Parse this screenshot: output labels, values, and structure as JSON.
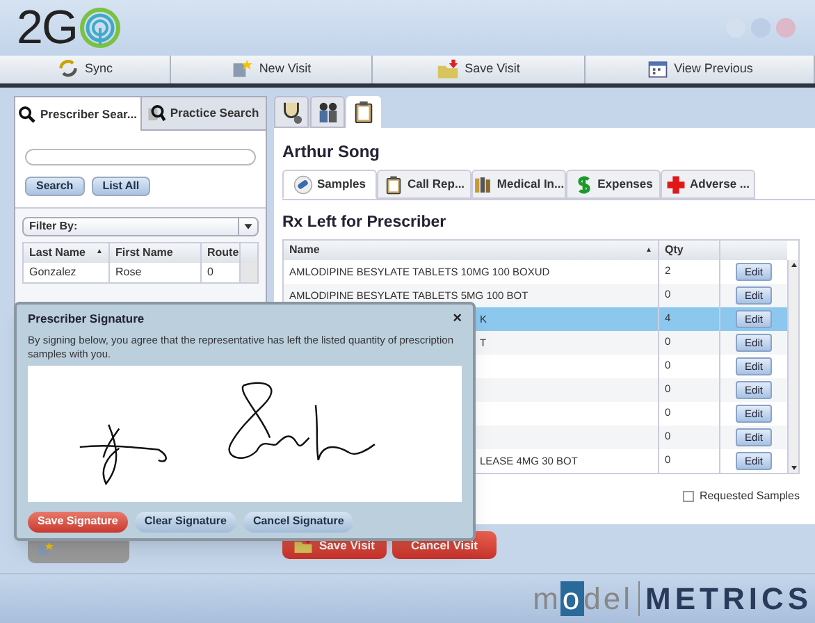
{
  "app": {
    "logo": "2G"
  },
  "toolbar": [
    {
      "kind": "sync",
      "label": "Sync"
    },
    {
      "kind": "new",
      "label": "New Visit"
    },
    {
      "kind": "save",
      "label": "Save Visit"
    },
    {
      "kind": "calendar",
      "label": "View Previous"
    }
  ],
  "search_panel": {
    "tabs": [
      {
        "kind": "person",
        "label": "Prescriber Sear...",
        "selected": true
      },
      {
        "kind": "building",
        "label": "Practice Search",
        "selected": false
      }
    ],
    "buttons": [
      "Search",
      "List All"
    ],
    "filter": {
      "value": "Filter By:"
    },
    "columns": [
      {
        "label": "Last Name",
        "sort": "▲"
      },
      {
        "label": "First Name"
      },
      {
        "label": "Route"
      }
    ],
    "rows": [
      [
        "Gonzalez",
        "Rose",
        "0"
      ]
    ]
  },
  "visit_tabs": [
    {
      "kind": "stethoscope",
      "selected": false
    },
    {
      "kind": "people",
      "selected": false
    },
    {
      "kind": "clipboard",
      "selected": true
    }
  ],
  "prescriber": "Arthur Song",
  "section_tabs": [
    {
      "kind": "pills",
      "label": "Samples",
      "selected": true
    },
    {
      "kind": "clipboard",
      "label": "Call Rep...",
      "selected": false
    },
    {
      "kind": "book",
      "label": "Medical In...",
      "selected": false
    },
    {
      "kind": "dollar",
      "label": "Expenses",
      "selected": false
    },
    {
      "kind": "cross",
      "label": "Adverse ...",
      "selected": false
    }
  ],
  "samples": {
    "title": "Rx Left for Prescriber",
    "columns": [
      {
        "label": "Name",
        "sort": "▲"
      },
      {
        "label": "Qty"
      }
    ],
    "rows": [
      {
        "kind": "full",
        "name": "AMLODIPINE BESYLATE TABLETS 10MG 100 BOXUD",
        "qty": "2",
        "action": "Edit",
        "selected": false
      },
      {
        "kind": "full",
        "name": "AMLODIPINE BESYLATE TABLETS 5MG 100 BOT",
        "qty": "0",
        "action": "Edit",
        "selected": false
      },
      {
        "kind": "partial",
        "name": "K",
        "qty": "4",
        "action": "Edit",
        "selected": true
      },
      {
        "kind": "partial",
        "name": "T",
        "qty": "0",
        "action": "Edit",
        "selected": false
      },
      {
        "kind": "partial",
        "qty": "0",
        "action": "Edit",
        "selected": false
      },
      {
        "kind": "partial",
        "qty": "0",
        "action": "Edit",
        "selected": false
      },
      {
        "kind": "partial",
        "qty": "0",
        "action": "Edit",
        "selected": false
      },
      {
        "kind": "partial",
        "qty": "0",
        "action": "Edit",
        "selected": false
      },
      {
        "kind": "partial",
        "name": "LEASE 4MG 30 BOT",
        "qty": "0",
        "action": "Edit",
        "selected": false
      }
    ],
    "requested": {
      "label": "Requested Samples",
      "checked": false
    }
  },
  "visit_actions": [
    {
      "kind": "save",
      "label": "Save Visit"
    },
    {
      "kind": "cancel",
      "label": "Cancel Visit"
    }
  ],
  "dialog": {
    "title": "Prescriber Signature",
    "message": "By signing below, you agree that the representative has left the listed quantity of prescription samples with you.",
    "close": "×",
    "buttons": [
      {
        "kind": "primary",
        "label": "Save Signature"
      },
      {
        "kind": "secondary",
        "label": "Clear Signature"
      },
      {
        "kind": "secondary",
        "label": "Cancel Signature"
      }
    ]
  },
  "footer": {
    "lead": "m",
    "mark": "o",
    "middle": "del",
    "tail": "METRICS"
  }
}
